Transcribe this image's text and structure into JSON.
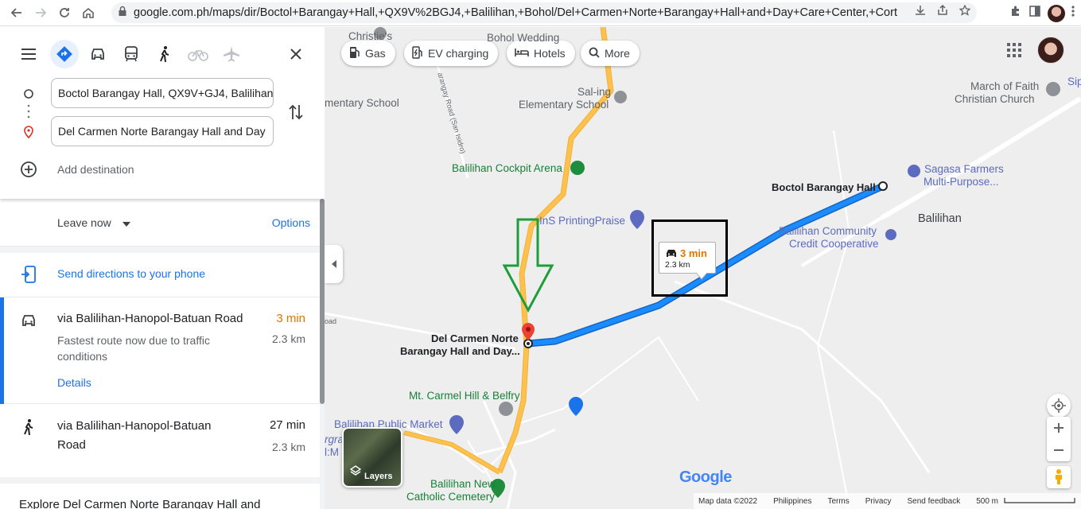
{
  "browser": {
    "url": "google.com.ph/maps/dir/Boctol+Barangay+Hall,+QX9V%2BGJ4,+Balilihan,+Bohol/Del+Carmen+Norte+Barangay+Hall+and+Day+Care+Center,+Corte..."
  },
  "directions": {
    "origin_value": "Boctol Barangay Hall, QX9V+GJ4, Balilihan",
    "destination_value": "Del Carmen Norte Barangay Hall and Day",
    "add_destination": "Add destination",
    "leave_now": "Leave now",
    "options": "Options",
    "send_to_phone": "Send directions to your phone",
    "modes": [
      "menu-icon",
      "best-route-icon",
      "car-icon",
      "transit-icon",
      "walk-icon",
      "bicycle-icon",
      "flight-icon"
    ]
  },
  "routes": [
    {
      "title": "via Balilihan-Hanopol-Batuan Road",
      "time": "3 min",
      "distance": "2.3 km",
      "description": "Fastest route now due to traffic conditions",
      "details": "Details",
      "mode": "car-icon",
      "time_color": "#e37400"
    },
    {
      "title": "via Balilihan-Hanopol-Batuan Road",
      "time": "27 min",
      "distance": "2.3 km",
      "mode": "walk-icon"
    }
  ],
  "explore": "Explore Del Carmen Norte Barangay Hall and",
  "map": {
    "chips": [
      "Gas",
      "EV charging",
      "Hotels",
      "More"
    ],
    "labels": {
      "christies": "Christie's",
      "bohol_wedding": "Bohol Wedding",
      "elementary_school_left": "mentary School",
      "sal_ing_1": "Sal-ing",
      "sal_ing_2": "Elementary School",
      "road_san_isidro": "arangay Road (San Isidro)",
      "march_of_faith_1": "March of Faith",
      "march_of_faith_2": "Christian Church",
      "sip": "Sip",
      "cockpit": "Balilihan Cockpit Arena",
      "sagasa_1": "Sagasa Farmers",
      "sagasa_2": "Multi-Purpose...",
      "boctol": "Boctol Barangay Hall",
      "balilihan": "Balilihan",
      "printing": "InS PrintingPraise",
      "community_1": "Balilihan Community",
      "community_2": "Credit Cooperative",
      "del_carmen_1": "Del Carmen Norte",
      "del_carmen_2": "Barangay Hall and Day...",
      "road_left": "oad",
      "mt_carmel": "Mt. Carmel Hill & Belfry",
      "public_market": "Balilihan Public Market",
      "balilihan_new_1": "Balilihan New",
      "balilihan_new_2": "Catholic Cemetery",
      "grave": "rgrave",
      "im": "l:M"
    },
    "callout_time": "3 min",
    "callout_distance": "2.3 km",
    "layers": "Layers",
    "google": "Google",
    "footer": [
      "Map data ©2022",
      "Philippines",
      "Terms",
      "Privacy",
      "Send feedback",
      "500 m"
    ],
    "route_color": "#1a8cff",
    "road_color": "#fdc150"
  }
}
